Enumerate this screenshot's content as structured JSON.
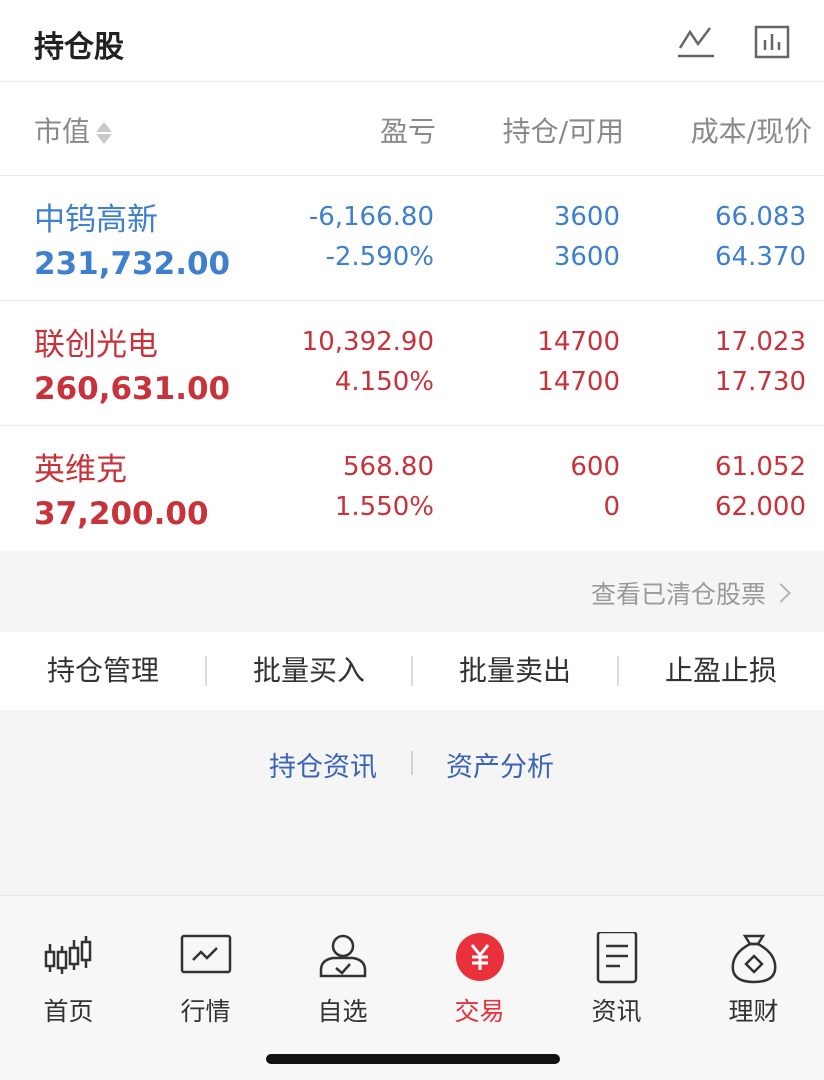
{
  "header": {
    "title": "持仓股",
    "icons": [
      "line-chart-icon",
      "bar-chart-icon"
    ]
  },
  "columns": {
    "market_value": "市值",
    "profit_loss": "盈亏",
    "holding_available": "持仓/可用",
    "cost_price": "成本/现价"
  },
  "holdings": [
    {
      "name": "中钨高新",
      "market_value": "231,732.00",
      "pl_amount": "-6,166.80",
      "pl_percent": "-2.590%",
      "holding": "3600",
      "available": "3600",
      "cost": "66.083",
      "price": "64.370",
      "color": "#3e7fcf"
    },
    {
      "name": "联创光电",
      "market_value": "260,631.00",
      "pl_amount": "10,392.90",
      "pl_percent": "4.150%",
      "holding": "14700",
      "available": "14700",
      "cost": "17.023",
      "price": "17.730",
      "color": "#c8323a"
    },
    {
      "name": "英维克",
      "market_value": "37,200.00",
      "pl_amount": "568.80",
      "pl_percent": "1.550%",
      "holding": "600",
      "available": "0",
      "cost": "61.052",
      "price": "62.000",
      "color": "#c8323a"
    }
  ],
  "clear_link": "查看已清仓股票",
  "actions": [
    "持仓管理",
    "批量买入",
    "批量卖出",
    "止盈止损"
  ],
  "links": [
    "持仓资讯",
    "资产分析"
  ],
  "tabs": [
    {
      "label": "首页",
      "icon": "candlestick-icon"
    },
    {
      "label": "行情",
      "icon": "market-chart-icon"
    },
    {
      "label": "自选",
      "icon": "user-check-icon"
    },
    {
      "label": "交易",
      "icon": "yuan-icon",
      "active": true
    },
    {
      "label": "资讯",
      "icon": "document-icon"
    },
    {
      "label": "理财",
      "icon": "money-bag-icon"
    }
  ],
  "colors": {
    "accent": "#e8313a",
    "link": "#3a63b8",
    "loss": "#3e7fcf",
    "gain": "#c8323a"
  }
}
